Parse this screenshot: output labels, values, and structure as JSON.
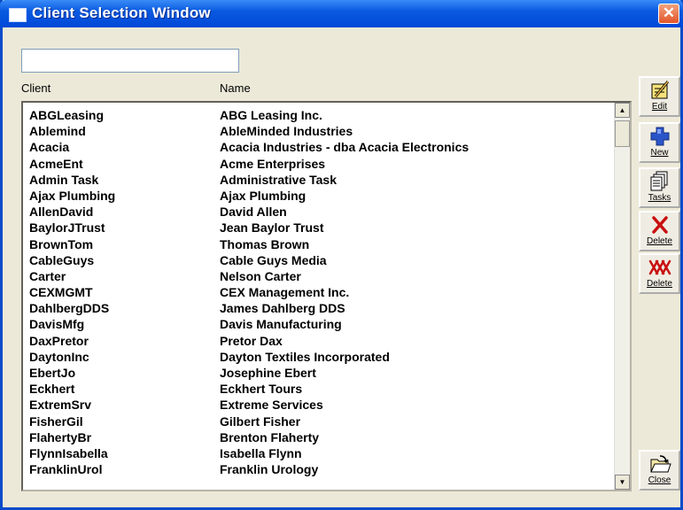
{
  "window": {
    "title": "Client Selection Window",
    "close_glyph": "✕"
  },
  "filter": {
    "value": "",
    "placeholder": ""
  },
  "columns": {
    "client": "Client",
    "name": "Name"
  },
  "rows": [
    {
      "client": "ABGLeasing",
      "name": "ABG Leasing Inc."
    },
    {
      "client": "Ablemind",
      "name": "AbleMinded Industries"
    },
    {
      "client": "Acacia",
      "name": "Acacia Industries - dba Acacia Electronics"
    },
    {
      "client": "AcmeEnt",
      "name": "Acme Enterprises"
    },
    {
      "client": "Admin Task",
      "name": "Administrative Task"
    },
    {
      "client": "Ajax Plumbing",
      "name": "Ajax Plumbing"
    },
    {
      "client": "AllenDavid",
      "name": "David Allen"
    },
    {
      "client": "BaylorJTrust",
      "name": "Jean Baylor Trust"
    },
    {
      "client": "BrownTom",
      "name": "Thomas Brown"
    },
    {
      "client": "CableGuys",
      "name": "Cable Guys Media"
    },
    {
      "client": "Carter",
      "name": "Nelson Carter"
    },
    {
      "client": "CEXMGMT",
      "name": "CEX Management Inc."
    },
    {
      "client": "DahlbergDDS",
      "name": "James Dahlberg DDS"
    },
    {
      "client": "DavisMfg",
      "name": "Davis Manufacturing"
    },
    {
      "client": "DaxPretor",
      "name": "Pretor Dax"
    },
    {
      "client": "DaytonInc",
      "name": "Dayton Textiles Incorporated"
    },
    {
      "client": "EbertJo",
      "name": "Josephine Ebert"
    },
    {
      "client": "Eckhert",
      "name": "Eckhert Tours"
    },
    {
      "client": "ExtremSrv",
      "name": "Extreme Services"
    },
    {
      "client": "FisherGil",
      "name": "Gilbert Fisher"
    },
    {
      "client": "FlahertyBr",
      "name": "Brenton Flaherty"
    },
    {
      "client": "FlynnIsabella",
      "name": "Isabella Flynn"
    },
    {
      "client": "FranklinUrol",
      "name": "Franklin Urology"
    }
  ],
  "toolbar": {
    "edit": {
      "label": "Edit",
      "icon": "edit-icon"
    },
    "new": {
      "label": "New",
      "icon": "new-icon"
    },
    "tasks": {
      "label": "Tasks",
      "icon": "tasks-icon"
    },
    "delete": {
      "label": "Delete",
      "icon": "delete-icon"
    },
    "delete_all": {
      "label": "Delete",
      "icon": "delete-all-icon"
    },
    "close": {
      "label": "Close",
      "icon": "close-folder-icon"
    }
  },
  "scrollbar": {
    "up_glyph": "▲",
    "down_glyph": "▼"
  },
  "colors": {
    "titlebar": "#0A5AE0",
    "window_bg": "#ECE9D8",
    "close_button": "#E2552A",
    "delete_icon": "#C81010",
    "new_icon": "#2A55C8"
  }
}
